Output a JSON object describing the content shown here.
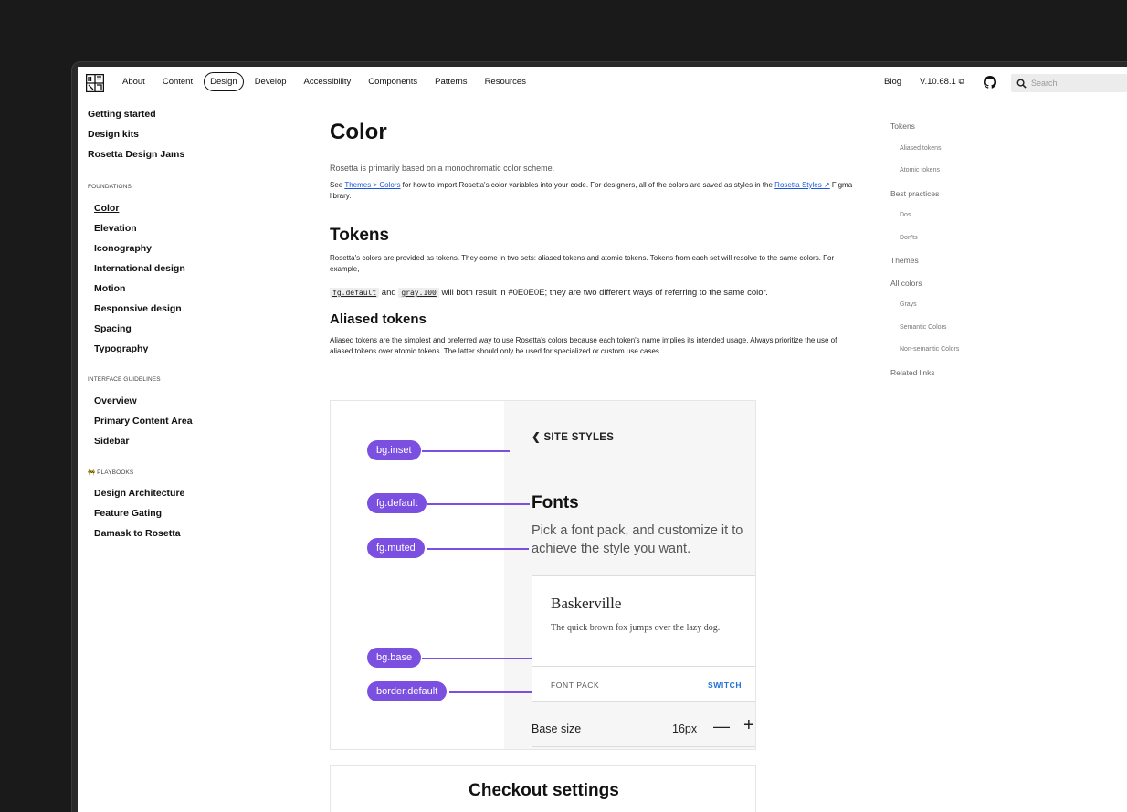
{
  "nav": {
    "logo": "rosetta-logo-icon",
    "links": [
      "About",
      "Content",
      "Design",
      "Develop",
      "Accessibility",
      "Components",
      "Patterns",
      "Resources"
    ],
    "active": "Design",
    "blog": "Blog",
    "version": "V.10.68.1",
    "version_icon": "external-link-icon",
    "github_icon": "github-icon",
    "search_placeholder": "Search"
  },
  "sidebar": {
    "top_items": [
      "Getting started",
      "Design kits",
      "Rosetta Design Jams"
    ],
    "foundations_label": "FOUNDATIONS",
    "foundations": [
      "Color",
      "Elevation",
      "Iconography",
      "International design",
      "Motion",
      "Responsive design",
      "Spacing",
      "Typography"
    ],
    "current": "Color",
    "interface_label": "INTERFACE GUIDELINES",
    "interface": [
      "Overview",
      "Primary Content Area",
      "Sidebar"
    ],
    "playbooks_label": "🚧 PLAYBOOKS",
    "playbooks": [
      "Design Architecture",
      "Feature Gating",
      "Damask to Rosetta"
    ]
  },
  "main": {
    "title": "Color",
    "lead": "Rosetta is primarily based on a monochromatic color scheme.",
    "intro_pre": "See ",
    "intro_link1": "Themes > Colors",
    "intro_mid": " for how to import Rosetta's color variables into your code. For designers, all of the colors are saved as styles in the ",
    "intro_link2": "Rosetta Styles ↗",
    "intro_post": " Figma library.",
    "tokens_heading": "Tokens",
    "tokens_para": "Rosetta's colors are provided as tokens. They come in two sets: aliased tokens and atomic tokens. Tokens from each set will resolve to the same colors. For example,",
    "code1": "fg.default",
    "code_and": " and ",
    "code2": "gray.100",
    "code_rest": " will both result in #0E0E0E; they are two different ways of referring to the same color.",
    "aliased_heading": "Aliased tokens",
    "aliased_para": "Aliased tokens are the simplest and preferred way to use Rosetta's colors because each token's name implies its intended usage. Always prioritize the use of aliased tokens over atomic tokens. The latter should only be used for specialized or custom use cases."
  },
  "illustration": {
    "pills": [
      "bg.inset",
      "fg.default",
      "fg.muted",
      "bg.base",
      "border.default"
    ],
    "back_label": "SITE STYLES",
    "fonts_title": "Fonts",
    "fonts_desc": "Pick a font pack, and customize it to achieve the style you want.",
    "font_name": "Baskerville",
    "font_sample": "The quick brown fox jumps over the lazy dog.",
    "font_pack_label": "FONT PACK",
    "switch_label": "SWITCH",
    "base_size_label": "Base size",
    "base_size_value": "16px",
    "accent": "#7b4fe0"
  },
  "checkout_title": "Checkout settings",
  "toc": [
    {
      "label": "Tokens",
      "level": 1
    },
    {
      "label": "Aliased tokens",
      "level": 2
    },
    {
      "label": "Atomic tokens",
      "level": 2
    },
    {
      "label": "Best practices",
      "level": 1
    },
    {
      "label": "Dos",
      "level": 2
    },
    {
      "label": "Don'ts",
      "level": 2
    },
    {
      "label": "Themes",
      "level": 1
    },
    {
      "label": "All colors",
      "level": 1
    },
    {
      "label": "Grays",
      "level": 2
    },
    {
      "label": "Semantic Colors",
      "level": 2
    },
    {
      "label": "Non-semantic Colors",
      "level": 2
    },
    {
      "label": "Related links",
      "level": 1
    }
  ]
}
